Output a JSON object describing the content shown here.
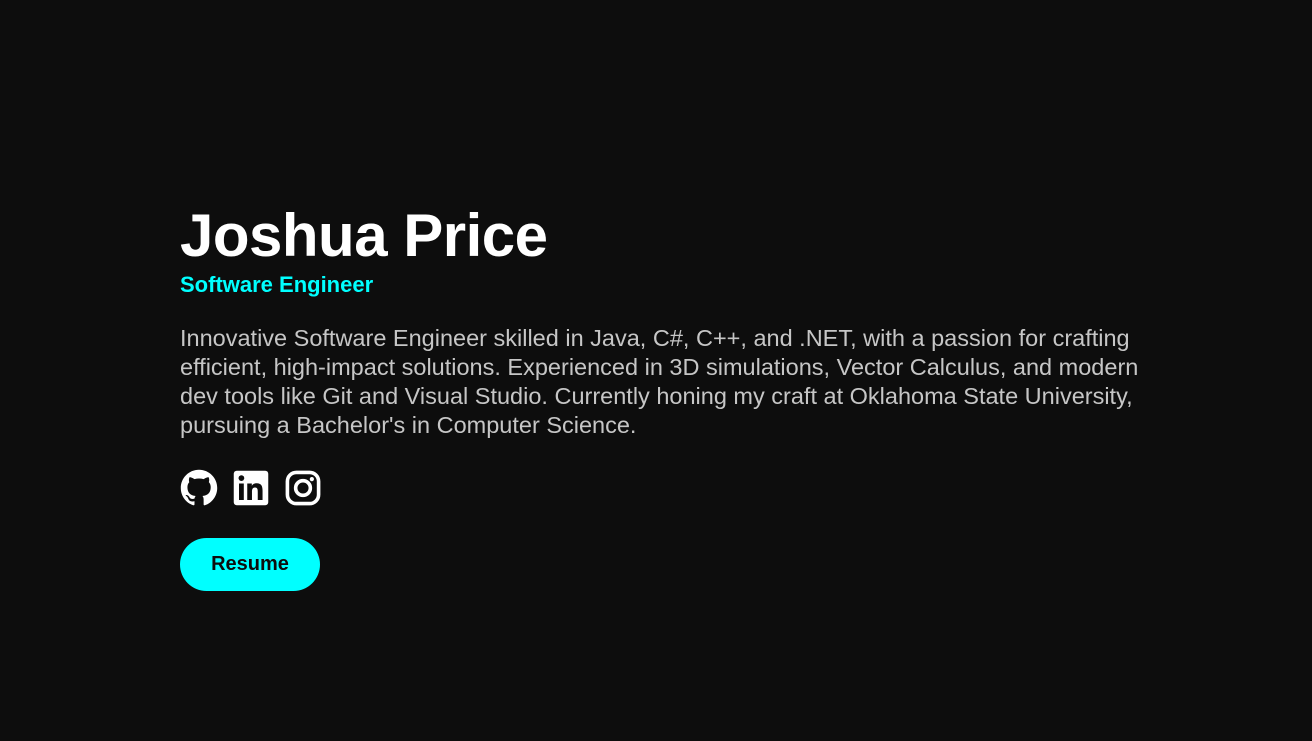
{
  "hero": {
    "name": "Joshua Price",
    "role": "Software Engineer",
    "bio": "Innovative Software Engineer skilled in Java, C#, C++, and .NET, with a passion for crafting efficient, high-impact solutions. Experienced in 3D simulations, Vector Calculus, and modern dev tools like Git and Visual Studio. Currently honing my craft at Oklahoma State University, pursuing a Bachelor's in Computer Science.",
    "resume_label": "Resume"
  },
  "socials": [
    {
      "icon": "github-icon"
    },
    {
      "icon": "linkedin-icon"
    },
    {
      "icon": "instagram-icon"
    }
  ],
  "colors": {
    "background": "#0d0d0d",
    "accent": "#00ffff",
    "heading": "#ffffff",
    "body_text": "#c6c6c6"
  }
}
